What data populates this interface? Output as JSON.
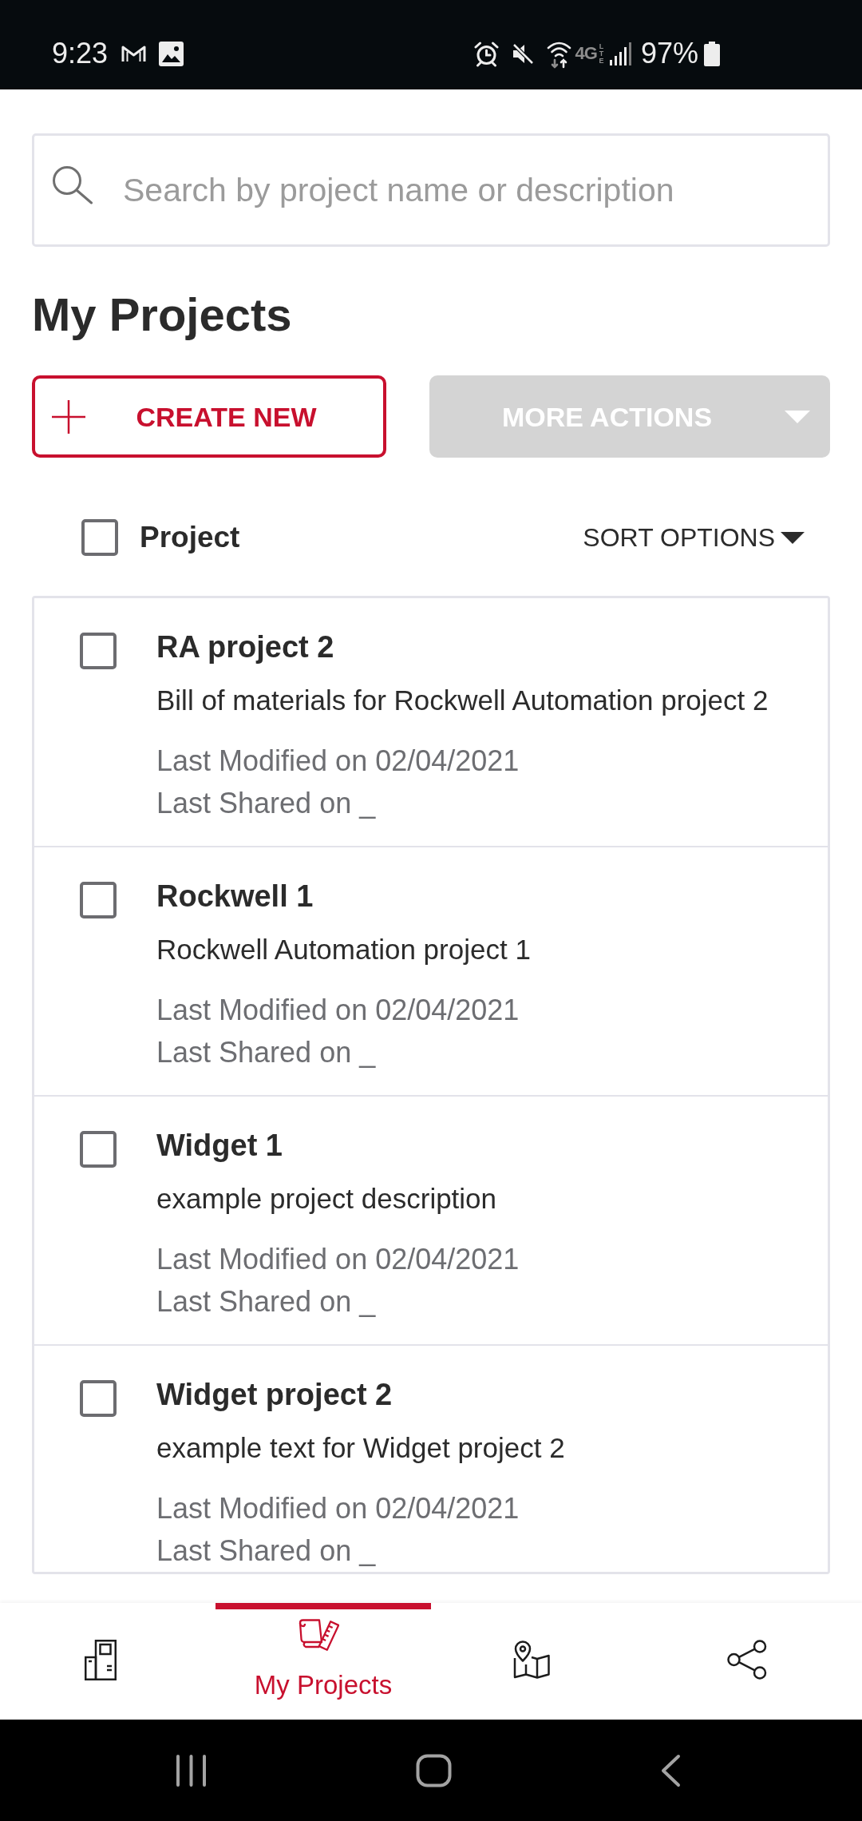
{
  "status_bar": {
    "time": "9:23",
    "network": "4G",
    "network_detail": "LTE",
    "battery": "97%"
  },
  "search": {
    "placeholder": "Search by project name or description"
  },
  "title": "My Projects",
  "actions": [
    {
      "kind": "create",
      "label": "CREATE NEW",
      "disabled": false
    },
    {
      "kind": "menu",
      "label": "MORE ACTIONS",
      "disabled": true
    }
  ],
  "list_header": {
    "label": "Project",
    "checked": false,
    "sort_label": "SORT OPTIONS"
  },
  "projects": [
    {
      "name": "RA project 2",
      "description": "Bill of materials for Rockwell Automation project 2",
      "modified": "Last Modified on 02/04/2021",
      "shared": "Last Shared on _",
      "checked": false
    },
    {
      "name": "Rockwell 1",
      "description": "Rockwell Automation project 1",
      "modified": "Last Modified on 02/04/2021",
      "shared": "Last Shared on _",
      "checked": false
    },
    {
      "name": "Widget 1",
      "description": "example project description",
      "modified": "Last Modified on 02/04/2021",
      "shared": "Last Shared on _",
      "checked": false
    },
    {
      "name": "Widget project 2",
      "description": "example text for Widget project 2",
      "modified": "Last Modified on 02/04/2021",
      "shared": "Last Shared on _",
      "checked": false
    }
  ],
  "bottom_nav": [
    {
      "selected": false
    },
    {
      "label": "My Projects",
      "selected": true
    },
    {
      "selected": false
    },
    {
      "selected": false
    }
  ]
}
